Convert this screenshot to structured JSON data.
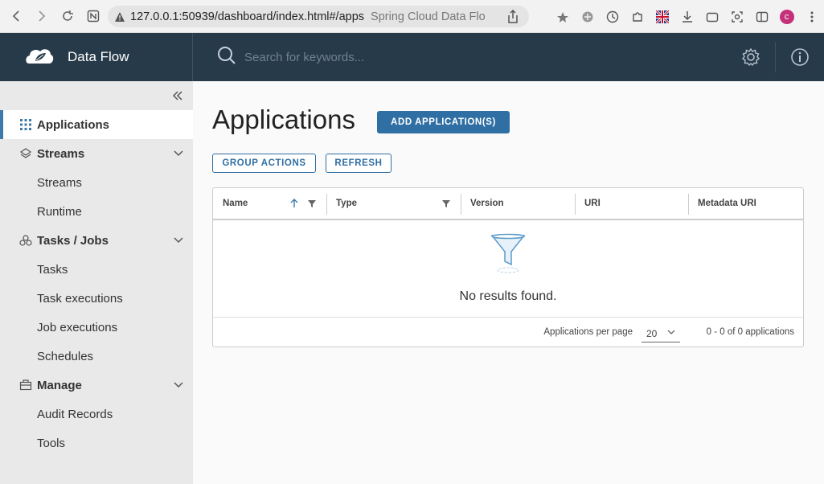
{
  "browser": {
    "url": "127.0.0.1:50939/dashboard/index.html#/apps",
    "tab_title": "Spring Cloud Data Flo",
    "profile_initial": "c"
  },
  "header": {
    "app_title": "Data Flow",
    "search_placeholder": "Search for keywords..."
  },
  "sidebar": {
    "items": [
      {
        "label": "Applications",
        "icon": "grid-icon",
        "active": true
      },
      {
        "label": "Streams",
        "icon": "streams-icon",
        "expandable": true
      },
      {
        "label": "Streams"
      },
      {
        "label": "Runtime"
      },
      {
        "label": "Tasks / Jobs",
        "icon": "tasks-icon",
        "expandable": true
      },
      {
        "label": "Tasks"
      },
      {
        "label": "Task executions"
      },
      {
        "label": "Job executions"
      },
      {
        "label": "Schedules"
      },
      {
        "label": "Manage",
        "icon": "manage-icon",
        "expandable": true
      },
      {
        "label": "Audit Records"
      },
      {
        "label": "Tools"
      }
    ]
  },
  "main": {
    "title": "Applications",
    "add_button": "ADD APPLICATION(S)",
    "group_actions_button": "GROUP ACTIONS",
    "refresh_button": "REFRESH",
    "columns": [
      "Name",
      "Type",
      "Version",
      "URI",
      "Metadata URI"
    ],
    "empty_message": "No results found.",
    "footer": {
      "per_page_label": "Applications per page",
      "per_page_value": "20",
      "range_text": "0 - 0 of 0 applications"
    }
  },
  "colors": {
    "header_bg": "#273a4a",
    "accent": "#2f6fa3",
    "sidebar_bg": "#e9e9e9"
  }
}
